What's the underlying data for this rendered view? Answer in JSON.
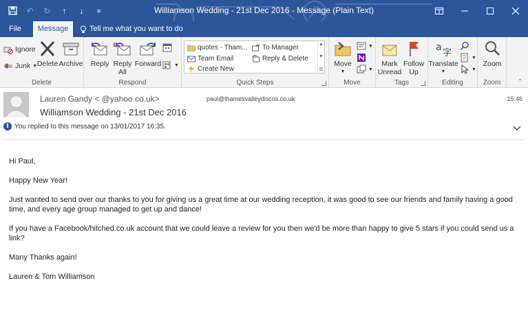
{
  "window": {
    "title": "Williamson Wedding - 21st Dec 2016  -  Message (Plain Text)"
  },
  "tabs": {
    "file": "File",
    "message": "Message",
    "tell_me": "Tell me what you want to do"
  },
  "ribbon": {
    "delete_group": {
      "label": "Delete",
      "ignore": "Ignore",
      "junk": "Junk",
      "delete": "Delete",
      "archive": "Archive"
    },
    "respond_group": {
      "label": "Respond",
      "reply": "Reply",
      "reply_all_1": "Reply",
      "reply_all_2": "All",
      "forward": "Forward"
    },
    "quick_steps": {
      "label": "Quick Steps",
      "items": [
        "quotes  - Tham...",
        "To Manager",
        "Team Email",
        "Reply & Delete",
        "Create New"
      ]
    },
    "move_group": {
      "label": "Move",
      "move": "Move"
    },
    "tags_group": {
      "label": "Tags",
      "mark_unread_1": "Mark",
      "mark_unread_2": "Unread",
      "follow_up_1": "Follow",
      "follow_up_2": "Up"
    },
    "editing_group": {
      "label": "Editing",
      "translate": "Translate"
    },
    "zoom_group": {
      "label": "Zoom",
      "zoom": "Zoom"
    }
  },
  "message": {
    "sender": "Lauren Gandy <          @yahoo.co.uk>",
    "recipient": "paul@thamesvalleydiscos.co.uk",
    "time": "15:46",
    "subject": "Williamson Wedding - 21st Dec 2016",
    "info": "You replied to this message on 13/01/2017 16:35.",
    "body": [
      "Hi Paul,",
      "Happy New Year!",
      "Just wanted to send over our thanks to you for giving us a great time at our wedding reception, it was good to see our friends and family having a good time, and every age group managed to get up and dance!",
      "If you have a Facebook/hitched.co.uk account that we could leave a review for you then we'd be more than happy to give 5 stars if you could send us a link?",
      "Many Thanks again!",
      "Lauren & Tom Williamson"
    ]
  },
  "colors": {
    "accent": "#2b579a",
    "ribbon_bg": "#f3f3f3"
  }
}
